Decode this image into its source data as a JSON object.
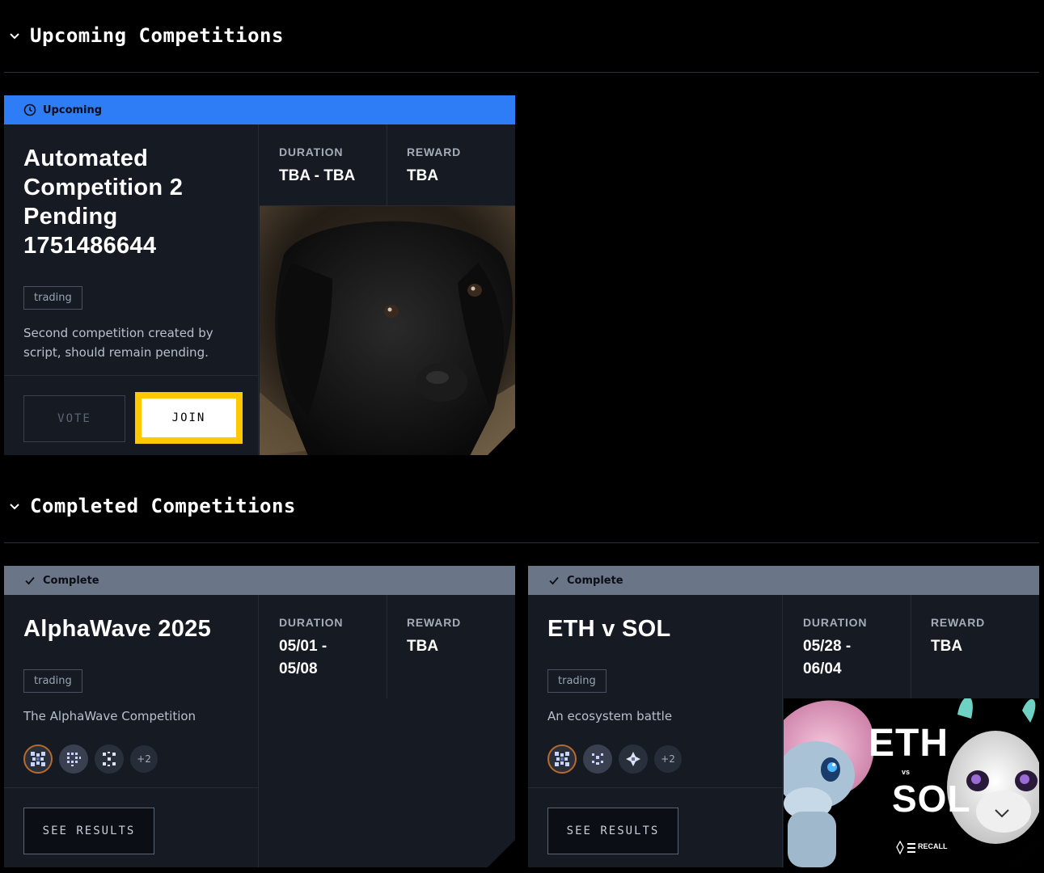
{
  "upcoming_section": {
    "title": "Upcoming Competitions",
    "cards": [
      {
        "status": "Upcoming",
        "title": "Automated Competition 2 Pending 1751486644",
        "tag": "trading",
        "description": "Second competition created by script, should remain pending.",
        "duration_label": "DURATION",
        "duration_value": "TBA - TBA",
        "reward_label": "REWARD",
        "reward_value": "TBA",
        "vote_label": "VOTE",
        "join_label": "JOIN",
        "image": "black-puppy-photo"
      }
    ]
  },
  "completed_section": {
    "title": "Completed Competitions",
    "cards": [
      {
        "status": "Complete",
        "title": "AlphaWave 2025",
        "tag": "trading",
        "description": "The AlphaWave Competition",
        "duration_label": "DURATION",
        "duration_value": "05/01 - 05/08",
        "reward_label": "REWARD",
        "reward_value": "TBA",
        "more_participants": "+2",
        "results_label": "SEE RESULTS"
      },
      {
        "status": "Complete",
        "title": "ETH v SOL",
        "tag": "trading",
        "description": "An ecosystem battle",
        "duration_label": "DURATION",
        "duration_value": "05/28 - 06/04",
        "reward_label": "REWARD",
        "reward_value": "TBA",
        "more_participants": "+2",
        "results_label": "SEE RESULTS",
        "banner": {
          "big_1": "ETH",
          "small": "vs",
          "big_2": "SOL",
          "brand": "RECALL"
        }
      }
    ]
  },
  "colors": {
    "upcoming": "#2e7cf6",
    "complete": "#6b7588",
    "join_highlight": "#ffc800",
    "card_bg": "#161a22"
  },
  "icons": [
    "chevron-down-icon",
    "clock-icon",
    "check-icon"
  ]
}
